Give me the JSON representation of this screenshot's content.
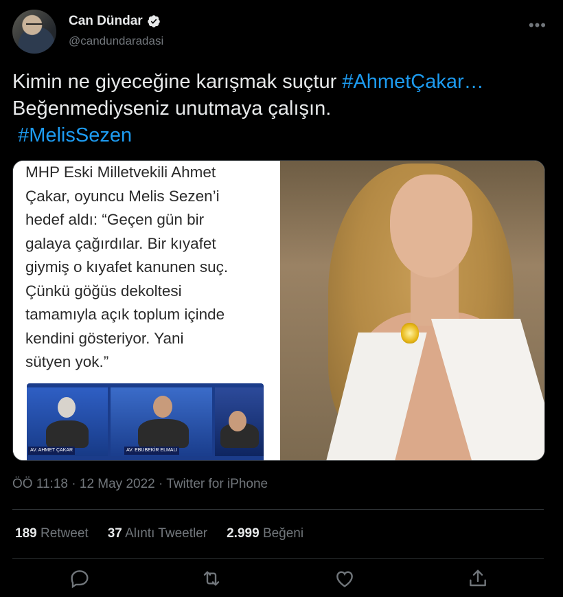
{
  "user": {
    "display_name": "Can Dündar",
    "handle": "@candundaradasi",
    "verified": true
  },
  "tweet": {
    "line1_text": "Kimin ne giyeceğine karışmak suçtur ",
    "line1_hashtag": "#AhmetÇakar…",
    "line2_text": "Beğenmediyseniz unutmaya çalışın.",
    "line3_hashtag": "#MelisSezen"
  },
  "media": {
    "quote_lines": [
      "MHP Eski Milletvekili Ahmet",
      "Çakar, oyuncu Melis Sezen’i",
      "hedef aldı: “Geçen gün bir",
      "galaya çağırdılar. Bir kıyafet",
      "giymiş o kıyafet kanunen suç.",
      "Çünkü göğüs dekoltesi",
      "tamamıyla açık toplum içinde",
      "kendini gösteriyor. Yani",
      "sütyen yok.”"
    ],
    "tv_label_1": "AV. AHMET ÇAKAR",
    "tv_label_2": "AV. EBUBEKİR ELMALI"
  },
  "meta": {
    "time": "ÖÖ 11:18",
    "date": "12 May 2022",
    "source": "Twitter for iPhone",
    "separator": " · "
  },
  "stats": {
    "retweets_count": "189",
    "retweets_label": "Retweet",
    "quotes_count": "37",
    "quotes_label": "Alıntı Tweetler",
    "likes_count": "2.999",
    "likes_label": "Beğeni"
  },
  "colors": {
    "background": "#000000",
    "text": "#e7e9ea",
    "secondary": "#71767b",
    "accent": "#1d9bf0",
    "divider": "#2f3336"
  },
  "icons": {
    "verified": "verified-badge-icon",
    "more": "more-options-icon",
    "reply": "reply-icon",
    "retweet": "retweet-icon",
    "like": "like-icon",
    "share": "share-icon"
  }
}
